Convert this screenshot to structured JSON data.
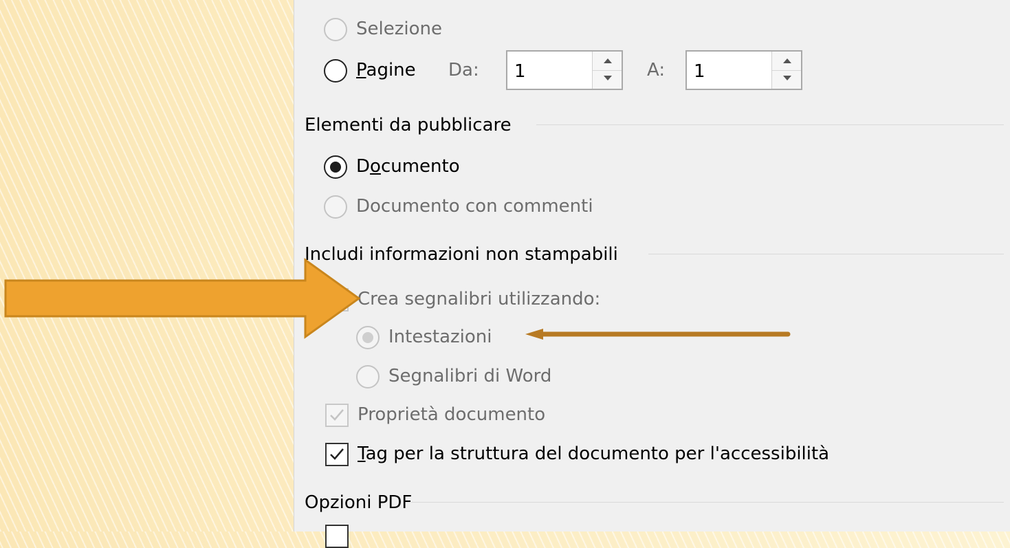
{
  "range": {
    "selection_label": "Selezione",
    "pages_label_prefix": "P",
    "pages_label_rest": "agine",
    "from_label": "Da:",
    "from_value": "1",
    "to_label": "A:",
    "to_value": "1"
  },
  "publish": {
    "heading": "Elementi da pubblicare",
    "document_prefix": "D",
    "document_underlined": "o",
    "document_rest": "cumento",
    "document_with_comments": "Documento con commenti",
    "selected": "document"
  },
  "nonprint": {
    "heading": "Includi informazioni non stampabili",
    "create_bookmarks": "Crea segnalibri utilizzando:",
    "create_bookmarks_checked": false,
    "headings_option": "Intestazioni",
    "word_bookmarks_option": "Segnalibri di Word",
    "doc_properties": "Proprietà documento",
    "doc_properties_checked": true,
    "tags_prefix": "T",
    "tags_rest": "ag per la struttura del documento per l'accessibilità",
    "tags_checked": true
  },
  "pdf_options": {
    "heading": "Opzioni PDF"
  },
  "annotations": {
    "big_arrow_color": "#eea22f",
    "thin_arrow_color": "#b77a24"
  }
}
